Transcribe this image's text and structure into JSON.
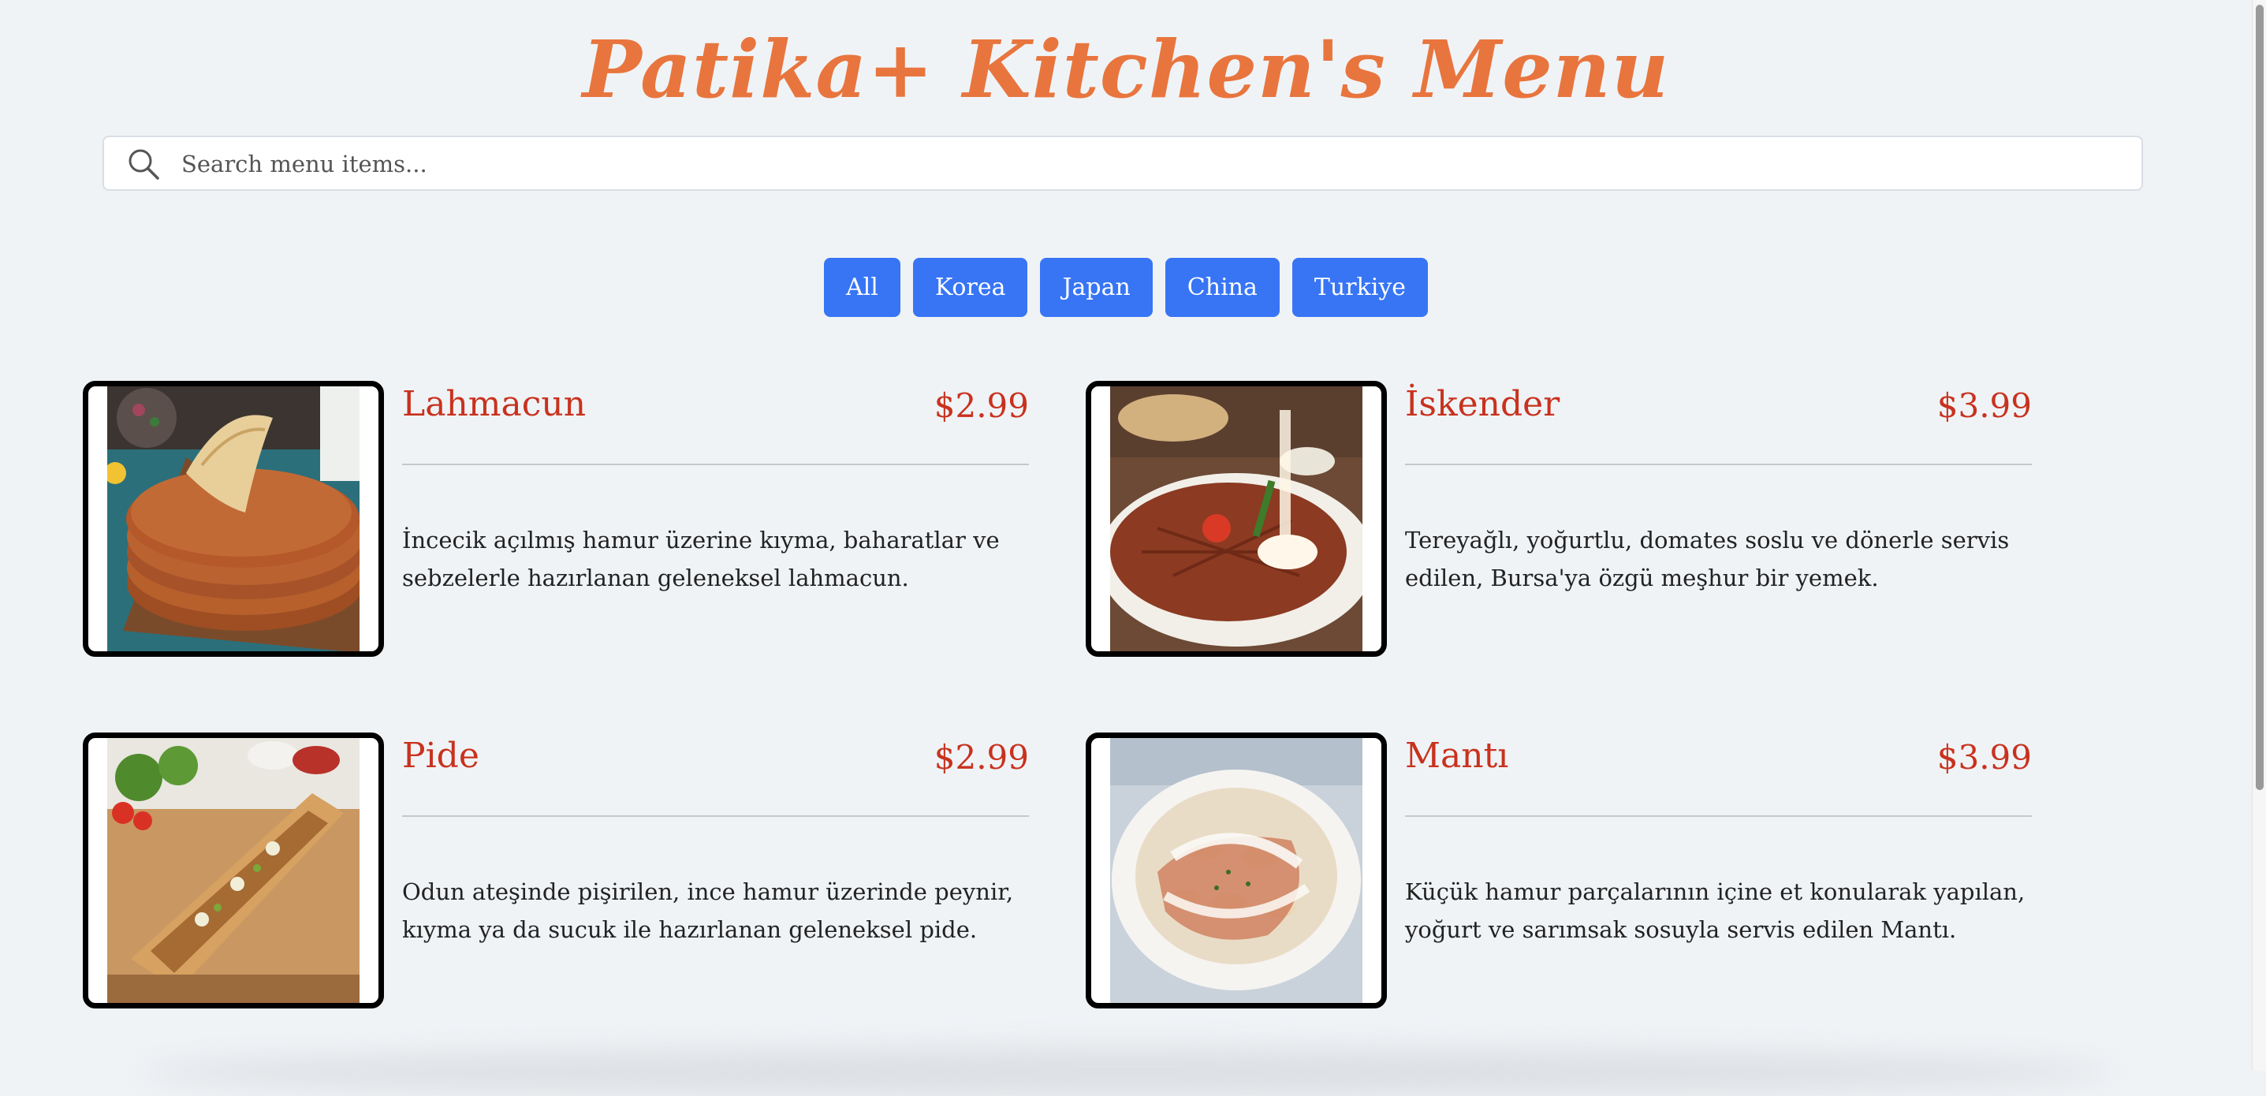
{
  "header": {
    "title": "Patika+ Kitchen's Menu"
  },
  "search": {
    "placeholder": "Search menu items...",
    "value": ""
  },
  "filters": [
    {
      "label": "All"
    },
    {
      "label": "Korea"
    },
    {
      "label": "Japan"
    },
    {
      "label": "China"
    },
    {
      "label": "Turkiye"
    }
  ],
  "menu": [
    {
      "name": "Lahmacun",
      "price": "$2.99",
      "description": "İncecik açılmış hamur üzerine kıyma, baharatlar ve sebzelerle hazırlanan geleneksel lahmacun."
    },
    {
      "name": "İskender",
      "price": "$3.99",
      "description": "Tereyağlı, yoğurtlu, domates soslu ve dönerle servis edilen, Bursa'ya özgü meşhur bir yemek."
    },
    {
      "name": "Pide",
      "price": "$2.99",
      "description": "Odun ateşinde pişirilen, ince hamur üzerinde peynir, kıyma ya da sucuk ile hazırlanan geleneksel pide."
    },
    {
      "name": "Mantı",
      "price": "$3.99",
      "description": "Küçük hamur parçalarının içine et konularak yapılan, yoğurt ve sarımsak sosuyla servis edilen Mantı."
    }
  ],
  "colors": {
    "background": "#f0f3f6",
    "title": "#e8753e",
    "accent_button": "#3775f5",
    "item_text": "#c8321e"
  },
  "icons": {
    "search": "search-icon"
  }
}
